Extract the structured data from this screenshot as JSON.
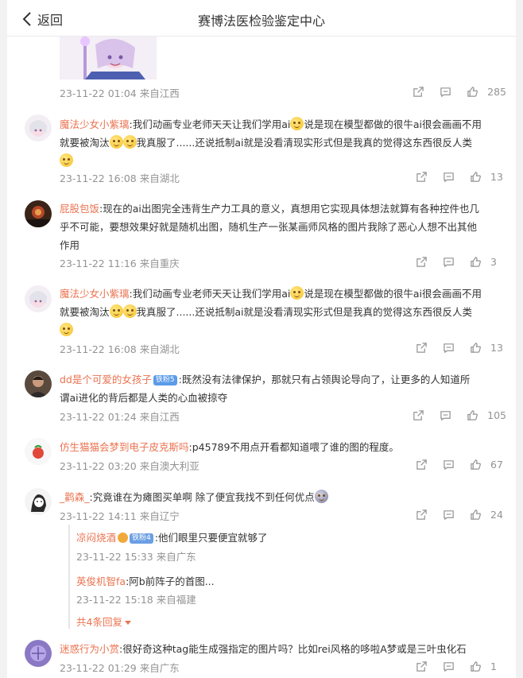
{
  "header": {
    "back_label": "返回",
    "title": "赛博法医检验鉴定中心"
  },
  "colors": {
    "accent": "#eb7350",
    "meta": "#939393",
    "text": "#333333"
  },
  "comments": [
    {
      "meta": "23-11-22 01:04 来自江西",
      "likes": "285"
    },
    {
      "user": "魔法少女小紫璃",
      "text_a": ":我们动画专业老师天天让我们学用ai",
      "text_b": "说是现在模型都做的很牛ai很会画画不用",
      "text_c": "就要被淘汰",
      "text_d": "我真服了......还说抵制ai就是没看清现实形式但是我真的觉得这东西很反人类",
      "meta": "23-11-22 16:08 来自湖北",
      "likes": "13"
    },
    {
      "user": "屁股包饭",
      "text_a": ":现在的ai出图完全违背生产力工具的意义，真想用它实现具体想法就算有各种控件也几",
      "text_b": "乎不可能，要想效果好就是随机出图，随机生产一张某画师风格的图片我除了恶心人想不出其他",
      "text_c": "作用",
      "meta": "23-11-22 11:16 来自重庆",
      "likes": "3"
    },
    {
      "user": "魔法少女小紫璃",
      "text_a": ":我们动画专业老师天天让我们学用ai",
      "text_b": "说是现在模型都做的很牛ai很会画画不用",
      "text_c": "就要被淘汰",
      "text_d": "我真服了......还说抵制ai就是没看清现实形式但是我真的觉得这东西很反人类",
      "meta": "23-11-22 16:08 来自湖北",
      "likes": "13"
    },
    {
      "user": "dd是个可爱的女孩子",
      "badge": "铁粉5",
      "text_a": ":既然没有法律保护，那就只有占领舆论导向了，让更多的人知道所",
      "text_b": "谓ai进化的背后都是人类的心血被掠夺",
      "meta": "23-11-22 01:24 来自江西",
      "likes": "105"
    },
    {
      "user": "仿生猫猫会梦到电子皮克斯吗",
      "text_a": ":p45789不用点开看都知道喂了谁的图的程度。",
      "meta": "23-11-22 03:20 来自澳大利亚",
      "likes": "67"
    },
    {
      "user": "_鹳森_",
      "text_a": ":究竟谁在为瘫图买单啊 除了便宜我找不到任何优点",
      "meta": "23-11-22 14:11 来自辽宁",
      "likes": "24",
      "replies": [
        {
          "user": "凉闷烧酒",
          "badge": "铁粉4",
          "text": ":他们眼里只要便宜就够了",
          "meta": "23-11-22 15:33 来自广东"
        },
        {
          "user": "英俊机智fa",
          "text": ":阿b前阵子的首图...",
          "meta": "23-11-22 15:18 来自福建"
        }
      ],
      "more_label": "共4条回复"
    },
    {
      "user": "迷惑行为小赏",
      "text_a": ":很好奇这种tag能生成强指定的图片吗？比如rei风格的哆啦A梦或是三叶虫化石",
      "meta": "23-11-22 01:29 来自广东",
      "likes": "1"
    }
  ]
}
